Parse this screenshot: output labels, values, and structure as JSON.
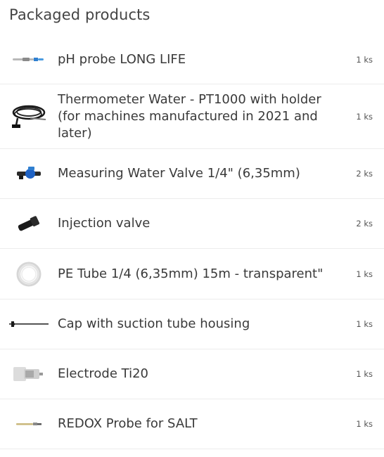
{
  "section": {
    "title": "Packaged products"
  },
  "products": [
    {
      "name": "pH probe LONG LIFE",
      "qty": "1 ks",
      "icon": "ph-probe-icon"
    },
    {
      "name": "Thermometer Water - PT1000 with holder (for machines manufactured in 2021 and later)",
      "qty": "1 ks",
      "icon": "thermometer-cable-icon"
    },
    {
      "name": "Measuring Water Valve 1/4\" (6,35mm)",
      "qty": "2 ks",
      "icon": "valve-icon"
    },
    {
      "name": "Injection valve",
      "qty": "2 ks",
      "icon": "injection-valve-icon"
    },
    {
      "name": "PE Tube 1/4 (6,35mm) 15m - transparent\"",
      "qty": "1 ks",
      "icon": "tube-coil-icon"
    },
    {
      "name": "Cap with suction tube housing",
      "qty": "1 ks",
      "icon": "suction-cap-icon"
    },
    {
      "name": "Electrode Ti20",
      "qty": "1 ks",
      "icon": "electrode-icon"
    },
    {
      "name": "REDOX Probe for SALT",
      "qty": "1 ks",
      "icon": "redox-probe-icon"
    }
  ]
}
